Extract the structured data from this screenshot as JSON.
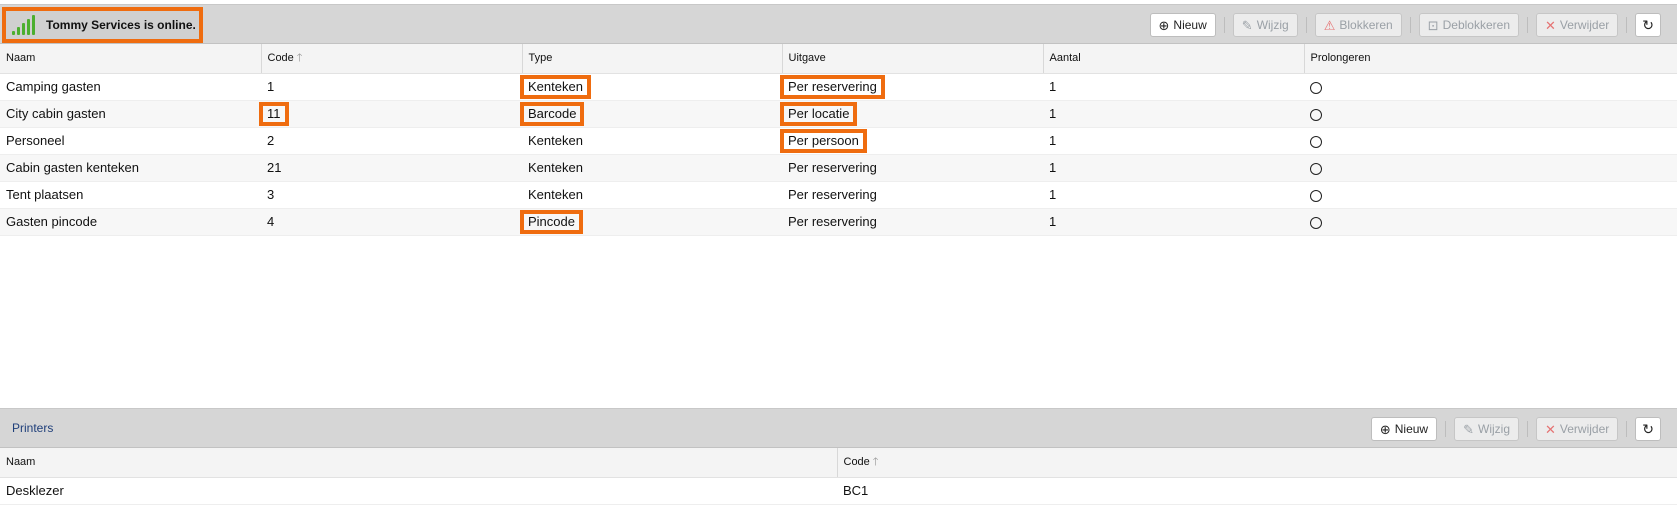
{
  "top": {
    "status_text": "Tommy Services is online.",
    "actions": {
      "new": "Nieuw",
      "edit": "Wijzig",
      "block": "Blokkeren",
      "unblock": "Deblokkeren",
      "delete": "Verwijder"
    },
    "columns": [
      "Naam",
      "Code",
      "Type",
      "Uitgave",
      "Aantal",
      "Prolongeren"
    ],
    "rows": [
      {
        "naam": "Camping gasten",
        "code": "1",
        "type": "Kenteken",
        "uitgave": "Per reservering",
        "aantal": "1"
      },
      {
        "naam": "City cabin gasten",
        "code": "11",
        "type": "Barcode",
        "uitgave": "Per locatie",
        "aantal": "1"
      },
      {
        "naam": "Personeel",
        "code": "2",
        "type": "Kenteken",
        "uitgave": "Per persoon",
        "aantal": "1"
      },
      {
        "naam": "Cabin gasten kenteken",
        "code": "21",
        "type": "Kenteken",
        "uitgave": "Per reservering",
        "aantal": "1"
      },
      {
        "naam": "Tent plaatsen",
        "code": "3",
        "type": "Kenteken",
        "uitgave": "Per reservering",
        "aantal": "1"
      },
      {
        "naam": "Gasten pincode",
        "code": "4",
        "type": "Pincode",
        "uitgave": "Per reservering",
        "aantal": "1"
      }
    ]
  },
  "printers": {
    "title": "Printers",
    "actions": {
      "new": "Nieuw",
      "edit": "Wijzig",
      "delete": "Verwijder"
    },
    "columns": [
      "Naam",
      "Code"
    ],
    "rows": [
      {
        "naam": "Desklezer",
        "code": "BC1"
      }
    ]
  },
  "colors": {
    "highlight": "#ef6c0f",
    "signal": "#4caf2f",
    "toolbar": "#d6d6d6"
  },
  "icons": [
    "signal-icon",
    "plus-circle-icon",
    "pencil-icon",
    "warning-icon",
    "unlock-icon",
    "close-icon",
    "refresh-icon",
    "sort-up-icon"
  ]
}
